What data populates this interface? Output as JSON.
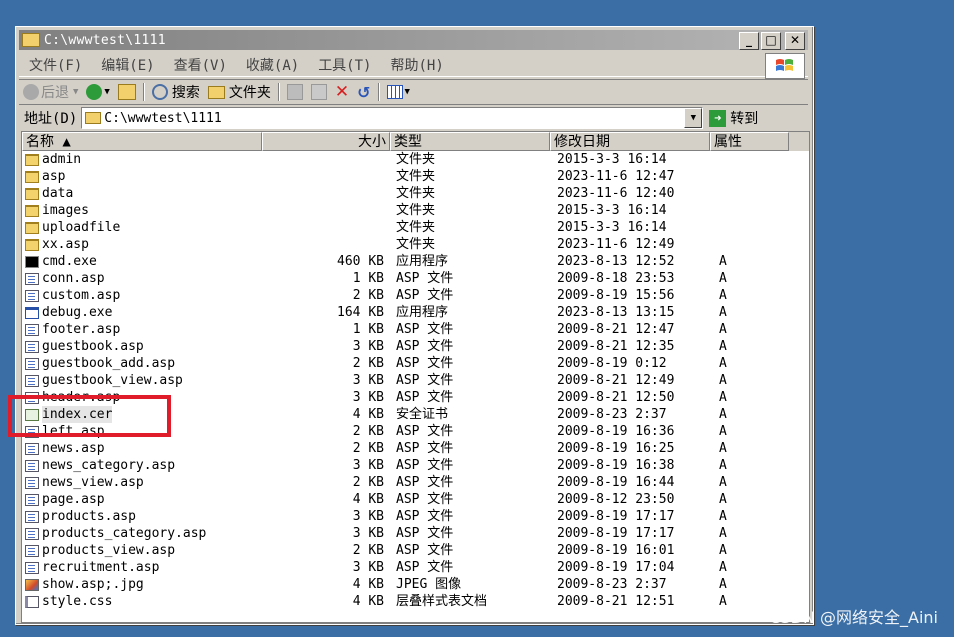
{
  "window": {
    "title": "C:\\wwwtest\\1111",
    "controls": {
      "minimize": "_",
      "maximize": "□",
      "close": "✕"
    }
  },
  "menubar": {
    "items": [
      "文件(F)",
      "编辑(E)",
      "查看(V)",
      "收藏(A)",
      "工具(T)",
      "帮助(H)"
    ]
  },
  "toolbar": {
    "back": "后退",
    "search": "搜索",
    "folders": "文件夹"
  },
  "address": {
    "label": "地址(D)",
    "value": "C:\\wwwtest\\1111",
    "go": "转到"
  },
  "columns": {
    "name": "名称 ▲",
    "size": "大小",
    "type": "类型",
    "date": "修改日期",
    "attr": "属性"
  },
  "files": [
    {
      "name": "admin",
      "size": "",
      "type": "文件夹",
      "date": "2015-3-3 16:14",
      "attr": "",
      "icon": "folder"
    },
    {
      "name": "asp",
      "size": "",
      "type": "文件夹",
      "date": "2023-11-6 12:47",
      "attr": "",
      "icon": "folder"
    },
    {
      "name": "data",
      "size": "",
      "type": "文件夹",
      "date": "2023-11-6 12:40",
      "attr": "",
      "icon": "folder"
    },
    {
      "name": "images",
      "size": "",
      "type": "文件夹",
      "date": "2015-3-3 16:14",
      "attr": "",
      "icon": "folder"
    },
    {
      "name": "uploadfile",
      "size": "",
      "type": "文件夹",
      "date": "2015-3-3 16:14",
      "attr": "",
      "icon": "folder"
    },
    {
      "name": "xx.asp",
      "size": "",
      "type": "文件夹",
      "date": "2023-11-6 12:49",
      "attr": "",
      "icon": "folder"
    },
    {
      "name": "cmd.exe",
      "size": "460 KB",
      "type": "应用程序",
      "date": "2023-8-13 12:52",
      "attr": "A",
      "icon": "cmd"
    },
    {
      "name": "conn.asp",
      "size": "1 KB",
      "type": "ASP 文件",
      "date": "2009-8-18 23:53",
      "attr": "A",
      "icon": "asp"
    },
    {
      "name": "custom.asp",
      "size": "2 KB",
      "type": "ASP 文件",
      "date": "2009-8-19 15:56",
      "attr": "A",
      "icon": "asp"
    },
    {
      "name": "debug.exe",
      "size": "164 KB",
      "type": "应用程序",
      "date": "2023-8-13 13:15",
      "attr": "A",
      "icon": "exe2"
    },
    {
      "name": "footer.asp",
      "size": "1 KB",
      "type": "ASP 文件",
      "date": "2009-8-21 12:47",
      "attr": "A",
      "icon": "asp"
    },
    {
      "name": "guestbook.asp",
      "size": "3 KB",
      "type": "ASP 文件",
      "date": "2009-8-21 12:35",
      "attr": "A",
      "icon": "asp"
    },
    {
      "name": "guestbook_add.asp",
      "size": "2 KB",
      "type": "ASP 文件",
      "date": "2009-8-19 0:12",
      "attr": "A",
      "icon": "asp"
    },
    {
      "name": "guestbook_view.asp",
      "size": "3 KB",
      "type": "ASP 文件",
      "date": "2009-8-21 12:49",
      "attr": "A",
      "icon": "asp"
    },
    {
      "name": "header.asp",
      "size": "3 KB",
      "type": "ASP 文件",
      "date": "2009-8-21 12:50",
      "attr": "A",
      "icon": "asp"
    },
    {
      "name": "index.cer",
      "size": "4 KB",
      "type": "安全证书",
      "date": "2009-8-23 2:37",
      "attr": "A",
      "icon": "cer"
    },
    {
      "name": "left.asp",
      "size": "2 KB",
      "type": "ASP 文件",
      "date": "2009-8-19 16:36",
      "attr": "A",
      "icon": "asp"
    },
    {
      "name": "news.asp",
      "size": "2 KB",
      "type": "ASP 文件",
      "date": "2009-8-19 16:25",
      "attr": "A",
      "icon": "asp"
    },
    {
      "name": "news_category.asp",
      "size": "3 KB",
      "type": "ASP 文件",
      "date": "2009-8-19 16:38",
      "attr": "A",
      "icon": "asp"
    },
    {
      "name": "news_view.asp",
      "size": "2 KB",
      "type": "ASP 文件",
      "date": "2009-8-19 16:44",
      "attr": "A",
      "icon": "asp"
    },
    {
      "name": "page.asp",
      "size": "4 KB",
      "type": "ASP 文件",
      "date": "2009-8-12 23:50",
      "attr": "A",
      "icon": "asp"
    },
    {
      "name": "products.asp",
      "size": "3 KB",
      "type": "ASP 文件",
      "date": "2009-8-19 17:17",
      "attr": "A",
      "icon": "asp"
    },
    {
      "name": "products_category.asp",
      "size": "3 KB",
      "type": "ASP 文件",
      "date": "2009-8-19 17:17",
      "attr": "A",
      "icon": "asp"
    },
    {
      "name": "products_view.asp",
      "size": "2 KB",
      "type": "ASP 文件",
      "date": "2009-8-19 16:01",
      "attr": "A",
      "icon": "asp"
    },
    {
      "name": "recruitment.asp",
      "size": "3 KB",
      "type": "ASP 文件",
      "date": "2009-8-19 17:04",
      "attr": "A",
      "icon": "asp"
    },
    {
      "name": "show.asp;.jpg",
      "size": "4 KB",
      "type": "JPEG 图像",
      "date": "2009-8-23 2:37",
      "attr": "A",
      "icon": "jpg"
    },
    {
      "name": "style.css",
      "size": "4 KB",
      "type": "层叠样式表文档",
      "date": "2009-8-21 12:51",
      "attr": "A",
      "icon": "css"
    }
  ],
  "watermark": "CSDN @网络安全_Aini",
  "colors": {
    "desktop": "#3a6ea5",
    "highlight_box": "#e01c2b"
  }
}
